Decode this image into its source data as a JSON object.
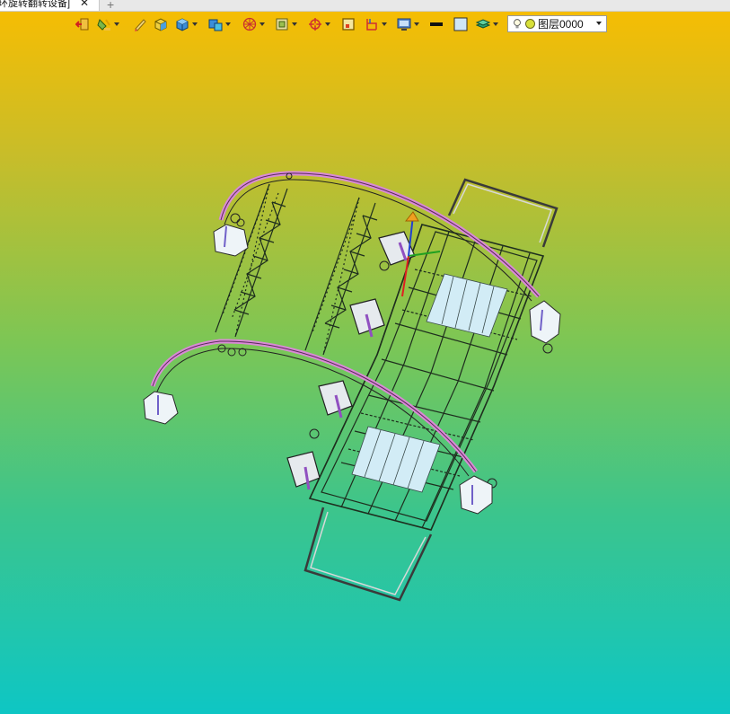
{
  "window": {
    "tab_title": "环旋转翻转设备]"
  },
  "tabs": {
    "close_glyph": "✕",
    "new_tab_glyph": "+"
  },
  "toolbar": {
    "items": [
      {
        "icon": "exit-door-icon",
        "has_dropdown": false
      },
      {
        "icon": "paint-bucket-icon",
        "has_dropdown": true
      },
      {
        "icon": "pencil-icon",
        "has_dropdown": false
      },
      {
        "icon": "solid-box-yellow-icon",
        "has_dropdown": false
      },
      {
        "icon": "solid-box-blue-icon",
        "has_dropdown": true
      },
      {
        "icon": "render-mode-icon",
        "has_dropdown": true
      },
      {
        "icon": "wireframe-sphere-icon",
        "has_dropdown": true
      },
      {
        "icon": "view-orient-icon",
        "has_dropdown": true
      },
      {
        "icon": "snap-target-icon",
        "has_dropdown": true
      },
      {
        "icon": "grid-frame-icon",
        "has_dropdown": false
      },
      {
        "icon": "section-plane-icon",
        "has_dropdown": true
      },
      {
        "icon": "display-settings-icon",
        "has_dropdown": true
      },
      {
        "icon": "line-color-icon",
        "has_dropdown": false
      },
      {
        "icon": "fill-color-icon",
        "has_dropdown": false
      },
      {
        "icon": "layer-stack-icon",
        "has_dropdown": true
      }
    ],
    "layer": {
      "name": "图层0000",
      "bulb_icon": "lightbulb-icon",
      "status_color": "#d8e03a"
    }
  },
  "colors": {
    "background_top": "#f9bd00",
    "background_bottom": "#0ec6c4",
    "rail_pink": "#d98ad6",
    "frame_dark": "#2a3a2a",
    "panel_light": "#cfe9f4"
  }
}
